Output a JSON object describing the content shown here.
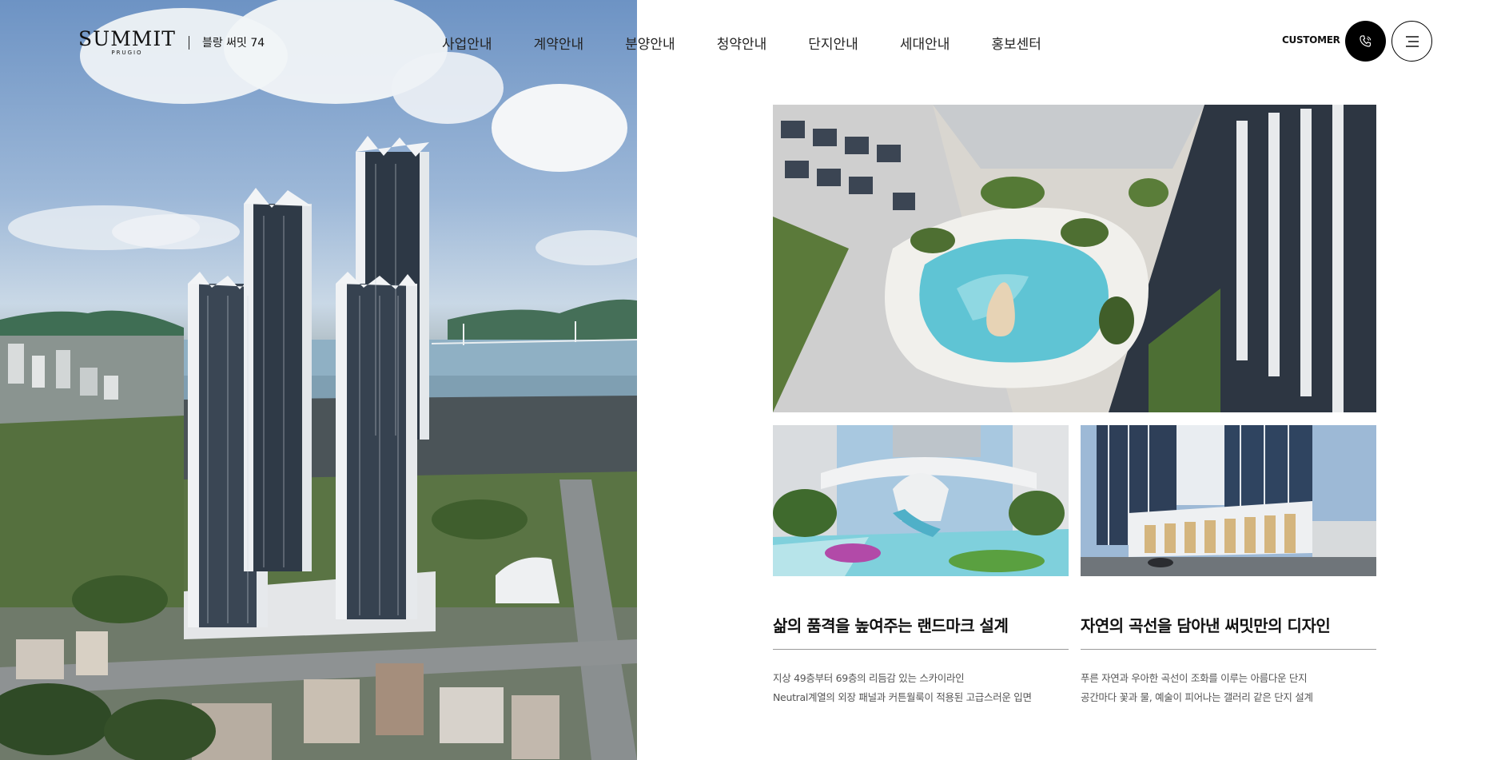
{
  "header": {
    "logo_main": "SUMMIT",
    "logo_sub": "PRUGIO",
    "project_name": "블랑 써밋 74",
    "nav": [
      "사업안내",
      "계약안내",
      "분양안내",
      "청약안내",
      "단지안내",
      "세대안내",
      "홍보센터"
    ],
    "customer_label": "CUSTOMER",
    "phone_icon": "phone-icon",
    "menu_icon": "hamburger-menu-icon"
  },
  "cards": [
    {
      "title": "삶의 품격을 높여주는 랜드마크 설계",
      "lines": [
        "지상 49층부터 69층의 리듬감 있는 스카이라인",
        "Neutral계열의 외장 패널과 커튼월룩이 적용된 고급스러운 입면"
      ]
    },
    {
      "title": "자연의 곡선을 담아낸 써밋만의 디자인",
      "lines": [
        "푸른 자연과 우아한 곡선이 조화를 이루는 아름다운 단지",
        "공간마다 꽃과 물, 예술이 피어나는 갤러리 같은 단지 설계"
      ]
    }
  ],
  "colors": {
    "accent": "#000000",
    "pool": "#5fc4d4"
  }
}
